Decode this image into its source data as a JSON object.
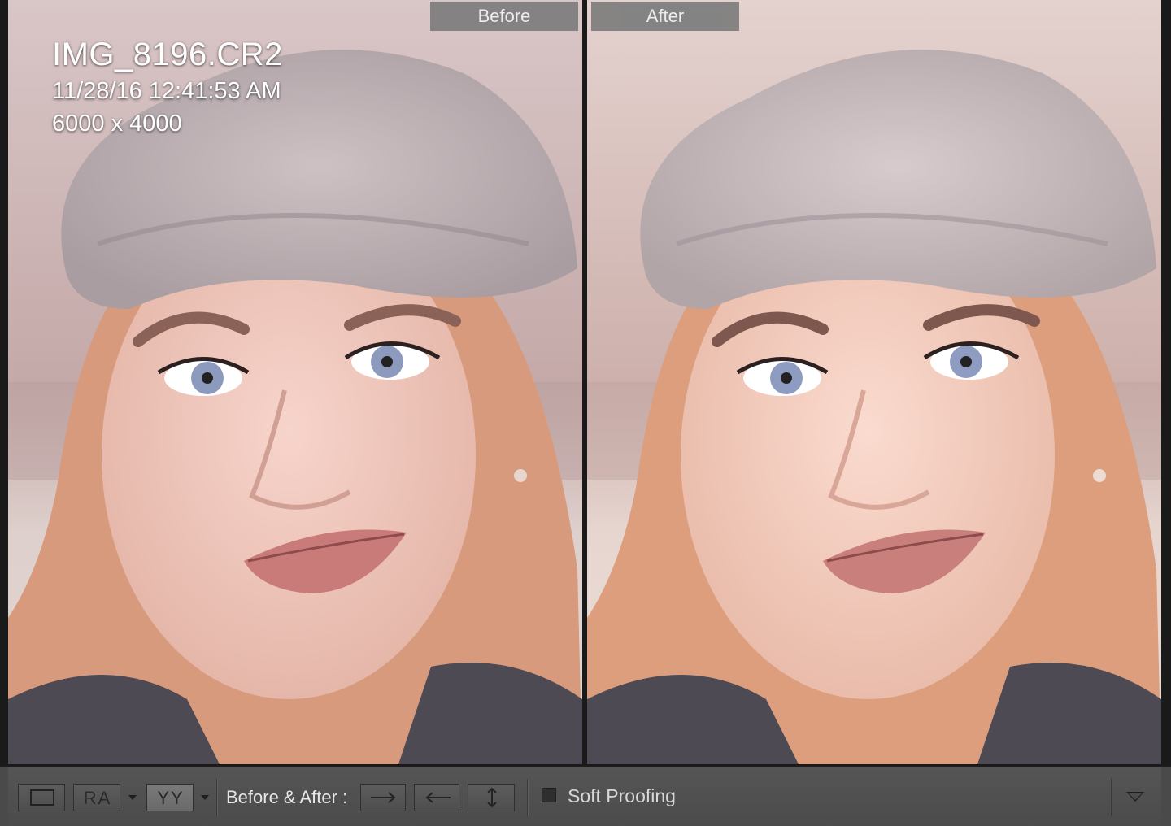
{
  "panes": {
    "before_label": "Before",
    "after_label": "After"
  },
  "image_info": {
    "filename": "IMG_8196.CR2",
    "datetime": "11/28/16 12:41:53 AM",
    "dimensions": "6000 x 4000"
  },
  "toolbar": {
    "loupe_view_icon": "single-frame-icon",
    "before_after_left_right": "RA",
    "before_after_top_bottom": "YY",
    "label": "Before & After :",
    "copy_before_to_after_icon": "arrow-right-icon",
    "copy_after_to_before_icon": "arrow-left-icon",
    "swap_icon": "swap-vertical-icon",
    "soft_proofing_label": "Soft Proofing",
    "soft_proofing_checked": false
  },
  "colors": {
    "label_bg": "#7d7d7d",
    "toolbar_bg": "#4a4a4a",
    "background": "#1a1a1a"
  }
}
